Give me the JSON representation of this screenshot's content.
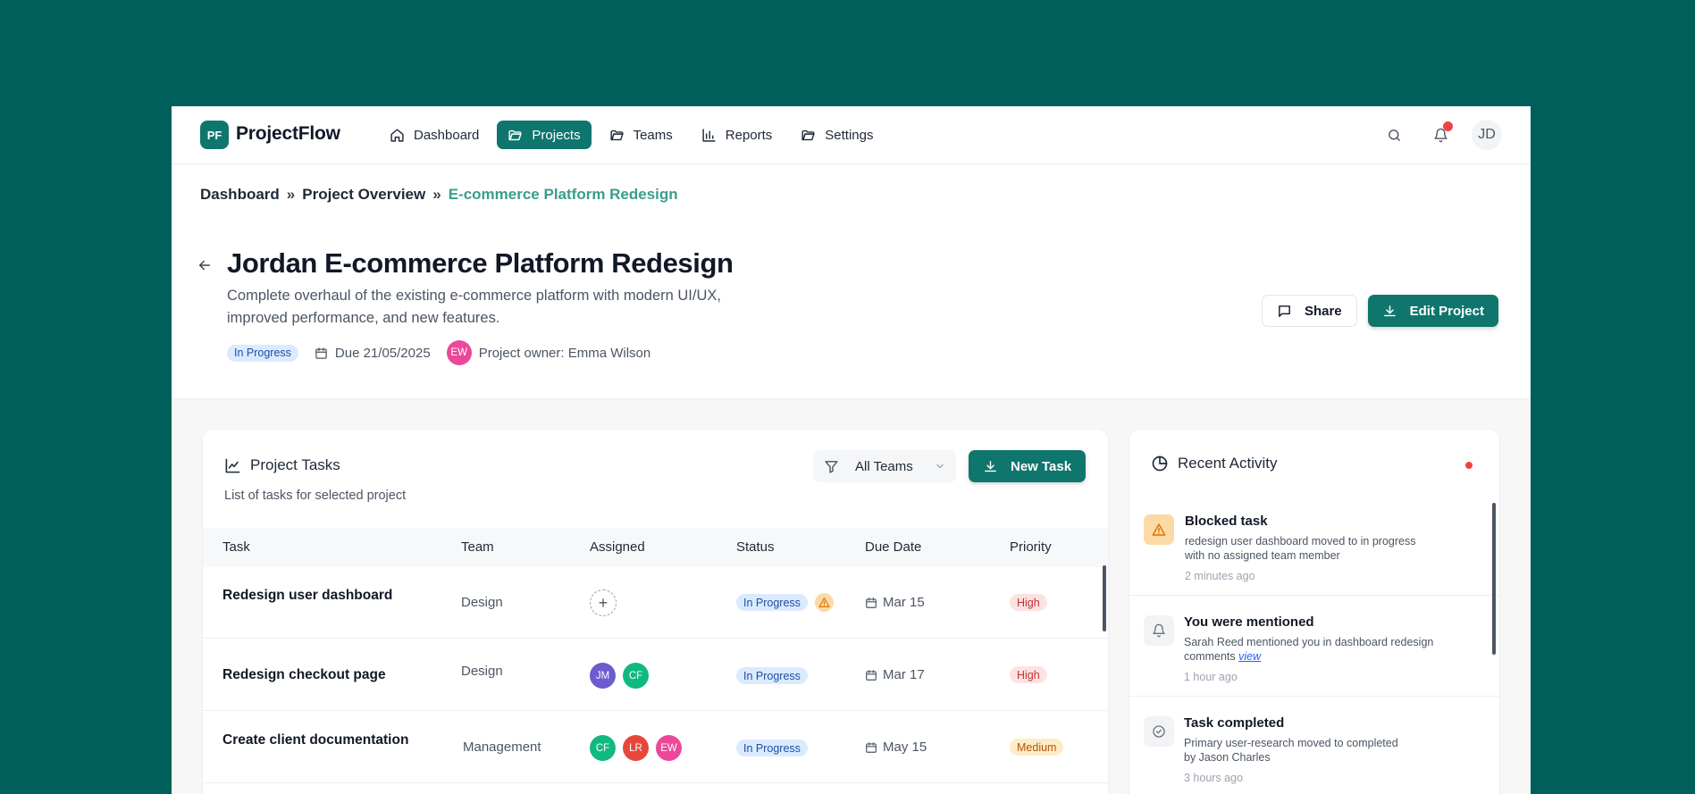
{
  "app": {
    "logo_badge": "PF",
    "name": "ProjectFlow"
  },
  "nav": {
    "items": [
      {
        "label": "Dashboard",
        "icon": "home-icon"
      },
      {
        "label": "Projects",
        "icon": "folder-icon",
        "active": true
      },
      {
        "label": "Teams",
        "icon": "folder-icon"
      },
      {
        "label": "Reports",
        "icon": "bar-chart-icon"
      },
      {
        "label": "Settings",
        "icon": "folder-icon"
      }
    ],
    "user_initials": "JD"
  },
  "breadcrumb": {
    "items": [
      "Dashboard",
      "Project Overview"
    ],
    "separator": "»",
    "current": "E-commerce Platform Redesign"
  },
  "project": {
    "title": "Jordan E-commerce Platform Redesign",
    "description": "Complete overhaul of the existing e-commerce platform with modern UI/UX, improved performance, and new features.",
    "status": "In Progress",
    "due": "Due 21/05/2025",
    "owner_initials": "EW",
    "owner": "Project owner: Emma Wilson"
  },
  "actions": {
    "share": "Share",
    "edit": "Edit Project"
  },
  "tasks": {
    "title": "Project Tasks",
    "subtitle": "List of tasks for selected project",
    "filter": "All Teams",
    "new_task": "New Task",
    "columns": [
      "Task",
      "Team",
      "Assigned",
      "Status",
      "Due Date",
      "Priority"
    ],
    "rows": [
      {
        "task": "Redesign user dashboard",
        "team": "Design",
        "assigned": [],
        "status": "In Progress",
        "blocked": true,
        "due": "Mar 15",
        "priority": "High"
      },
      {
        "task": "Redesign checkout page",
        "team": "Design",
        "assigned": [
          {
            "initials": "JM",
            "color": "#6d5bd0"
          },
          {
            "initials": "CF",
            "color": "#10b981"
          }
        ],
        "status": "In Progress",
        "due": "Mar 17",
        "priority": "High"
      },
      {
        "task": "Create client documentation",
        "team": "Management",
        "assigned": [
          {
            "initials": "CF",
            "color": "#10b981"
          },
          {
            "initials": "LR",
            "color": "#e5483b"
          },
          {
            "initials": "EW",
            "color": "#ec4899"
          }
        ],
        "status": "In Progress",
        "due": "May 15",
        "priority": "Medium"
      }
    ]
  },
  "activity": {
    "title": "Recent Activity",
    "items": [
      {
        "title": "Blocked task",
        "line1": "redesign user dashboard moved to in progress",
        "line2": "with no assigned team member",
        "time": "2 minutes ago",
        "icon": "warning-icon"
      },
      {
        "title": "You were mentioned",
        "line1": "Sarah Reed mentioned you in dashboard redesign",
        "line2": "comments",
        "link": "view",
        "time": "1 hour ago",
        "icon": "bell-icon"
      },
      {
        "title": "Task completed",
        "line1": "Primary user-research moved to completed",
        "line2": "by Jason Charles",
        "time": "3 hours ago",
        "icon": "check-circle-icon"
      }
    ]
  },
  "colors": {
    "brand": "#0f766e",
    "background": "#005f5b",
    "alert": "#ef4444"
  }
}
